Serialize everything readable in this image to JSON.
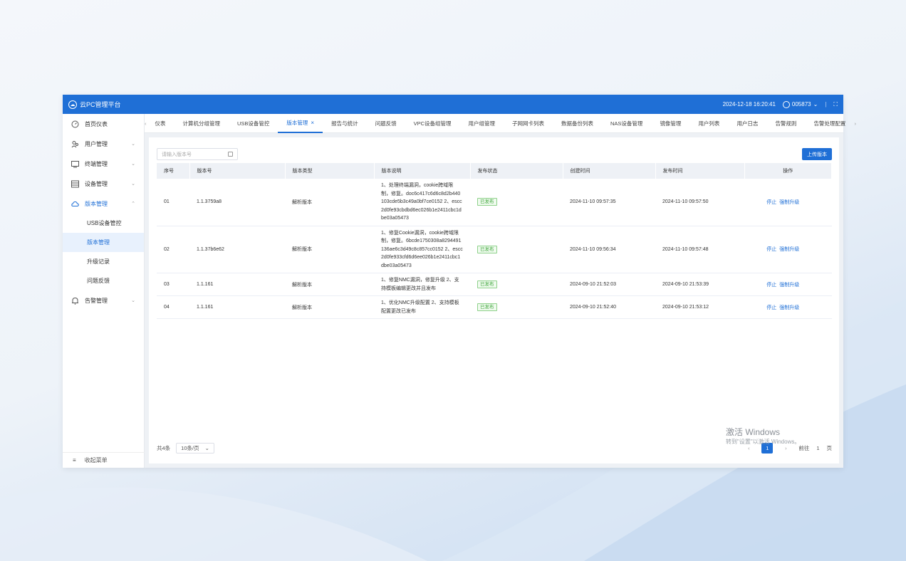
{
  "app": {
    "title": "云PC管理平台",
    "datetime": "2024-12-18 16:20:41",
    "user": "005873"
  },
  "sidebar": {
    "items": [
      {
        "label": "首页仪表",
        "icon": "dashboard-icon",
        "has_children": false
      },
      {
        "label": "用户管理",
        "icon": "users-icon",
        "has_children": true
      },
      {
        "label": "终端管理",
        "icon": "monitor-icon",
        "has_children": true
      },
      {
        "label": "设备管理",
        "icon": "server-icon",
        "has_children": true
      },
      {
        "label": "版本管理",
        "icon": "cloud-icon",
        "has_children": true,
        "expanded": true
      }
    ],
    "sub_items": [
      "USB设备管控",
      "版本管理",
      "升级记录",
      "问题反馈"
    ],
    "active_sub": 1,
    "after_items": [
      {
        "label": "告警管理",
        "icon": "bell-icon",
        "has_children": true
      }
    ],
    "footer_label": "收起菜单"
  },
  "tabs": [
    "仪表",
    "计算机分组管理",
    "USB设备管控",
    "版本管理",
    "报告与统计",
    "问题反馈",
    "VPC设备组管理",
    "用户组管理",
    "子网网卡列表",
    "数据备份列表",
    "NAS设备管理",
    "镜像管理",
    "用户列表",
    "用户日志",
    "告警规则",
    "告警处理配置"
  ],
  "active_tab": 3,
  "search": {
    "placeholder": "请输入版本号"
  },
  "upload_label": "上传版本",
  "table": {
    "headers": [
      "序号",
      "版本号",
      "版本类型",
      "版本说明",
      "发布状态",
      "创建时间",
      "发布时间",
      "操作"
    ],
    "rows": [
      {
        "no": "01",
        "version": "1.1.3759a8",
        "type": "解析版本",
        "desc": "1、处理终端漏洞，cookie跨域限制，修复。doc6c417c6d6c8d2b440103cde5b3c49a0bf7ce0152 2、escc2d0fe93cbdbd6ec026b1e2411cbc1dbe03a05473",
        "status": "已发布",
        "created": "2024-11-10 09:57:35",
        "published": "2024-11-10 09:57:50",
        "ops": [
          "停止",
          "强制升级"
        ]
      },
      {
        "no": "02",
        "version": "1.1.37b6e62",
        "type": "解析版本",
        "desc": "1、修复Cookie漏洞，cookie跨域限制，修复。6bcde1750308a8294491136ae6c3d49c8c857cc0152 2、escc2d0fe933cfd6d6ee026b1e2411cbc1dbe03a05473",
        "status": "已发布",
        "created": "2024-11-10 09:56:34",
        "published": "2024-11-10 09:57:48",
        "ops": [
          "停止",
          "强制升级"
        ]
      },
      {
        "no": "03",
        "version": "1.1.161",
        "type": "解析版本",
        "desc": "1、修复NMC漏洞，修复升级 2、支持模板编辑更改并且发布",
        "status": "已发布",
        "created": "2024-09-10 21:52:03",
        "published": "2024-09-10 21:53:39",
        "ops": [
          "停止",
          "强制升级"
        ]
      },
      {
        "no": "04",
        "version": "1.1.161",
        "type": "解析版本",
        "desc": "1、优化NMC升级配置 2、支持模板配置更改已发布",
        "status": "已发布",
        "created": "2024-09-10 21:52:40",
        "published": "2024-09-10 21:53:12",
        "ops": [
          "停止",
          "强制升级"
        ]
      }
    ]
  },
  "pager": {
    "total": "共4条",
    "page_size": "10条/页",
    "current": "1",
    "goto_label": "前往",
    "goto_value": "1",
    "page_unit": "页"
  },
  "watermark": {
    "title": "激活 Windows",
    "subtitle": "转到\"设置\"以激活 Windows。"
  }
}
